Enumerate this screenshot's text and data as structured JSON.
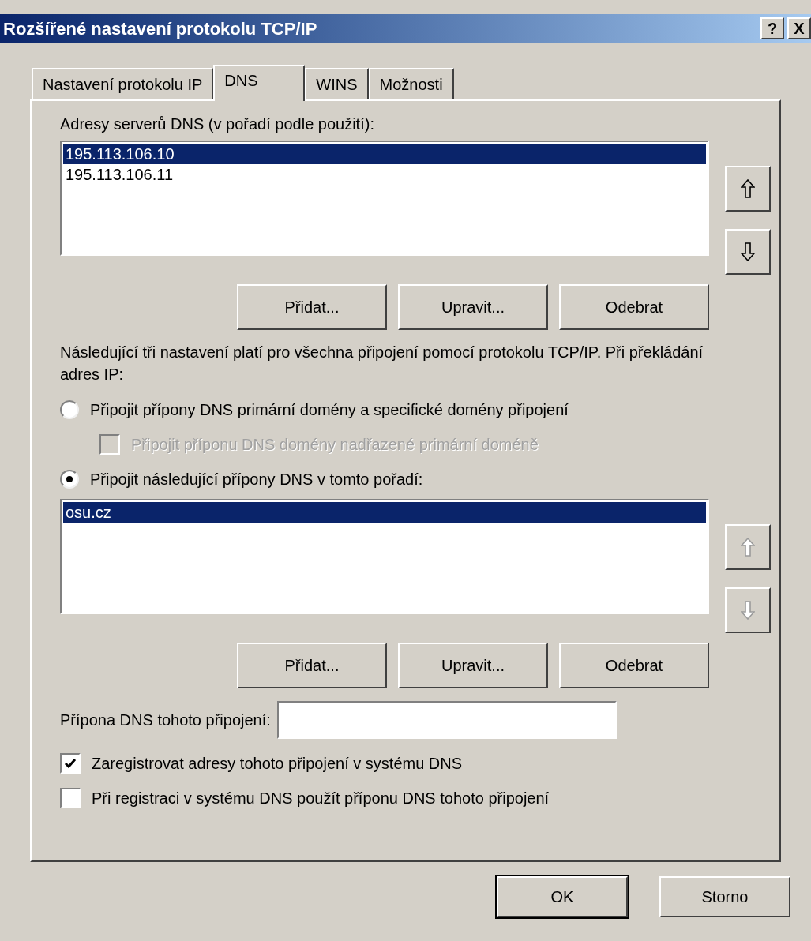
{
  "window": {
    "title": "Rozšířené nastavení protokolu TCP/IP",
    "title_buttons": [
      "?",
      "X"
    ]
  },
  "tabs": [
    {
      "label": "Nastavení protokolu IP",
      "selected": false
    },
    {
      "label": "DNS",
      "selected": true
    },
    {
      "label": "WINS",
      "selected": false
    },
    {
      "label": "Možnosti",
      "selected": false
    }
  ],
  "dns_servers": {
    "label": "Adresy serverů DNS (v pořadí podle použití):",
    "items": [
      {
        "text": "195.113.106.10",
        "selected": true
      },
      {
        "text": "195.113.106.11",
        "selected": false
      }
    ],
    "move_up": {
      "disabled": false
    },
    "move_down": {
      "disabled": false
    },
    "buttons": [
      "Přidat...",
      "Upravit...",
      "Odebrat"
    ]
  },
  "description": "Následující tři nastavení platí pro všechna připojení pomocí protokolu TCP/IP. Při překládání adres IP:",
  "options": [
    {
      "kind": "radio",
      "label": "Připojit přípony DNS primární domény a specifické domény připojení",
      "selected": false,
      "disabled": false
    },
    {
      "kind": "checkbox",
      "label": "Připojit příponu DNS domény nadřazené primární doméně",
      "checked": false,
      "disabled": true
    },
    {
      "kind": "radio",
      "label": "Připojit následující přípony DNS v tomto pořadí:",
      "selected": true,
      "disabled": false
    }
  ],
  "suffixes": {
    "items": [
      {
        "text": "osu.cz",
        "selected": true
      }
    ],
    "move_up": {
      "disabled": true
    },
    "move_down": {
      "disabled": true
    },
    "buttons": [
      "Přidat...",
      "Upravit...",
      "Odebrat"
    ]
  },
  "connection_suffix": {
    "label": "Přípona DNS tohoto připojení:"
  },
  "checkboxes": [
    {
      "label": "Zaregistrovat adresy tohoto připojení v systému DNS",
      "checked": true
    },
    {
      "label": "Při registraci v systému DNS použít příponu DNS tohoto připojení",
      "checked": false
    }
  ],
  "footer_buttons": [
    {
      "label": "OK",
      "default": true
    },
    {
      "label": "Storno",
      "default": false
    }
  ]
}
